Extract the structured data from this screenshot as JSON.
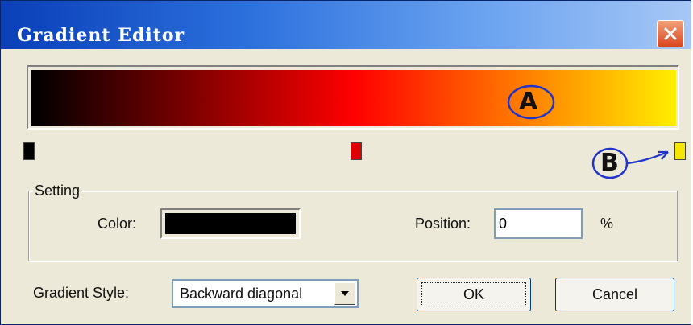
{
  "window": {
    "title": "Gradient Editor"
  },
  "gradient": {
    "colors": [
      "#000000",
      "#ff0000",
      "#ffee00"
    ]
  },
  "stops": [
    {
      "name": "stop-black",
      "color": "#000000"
    },
    {
      "name": "stop-red",
      "color": "#e00000"
    },
    {
      "name": "stop-yellow",
      "color": "#f5e600"
    }
  ],
  "annotations": {
    "a": "A",
    "b": "B",
    "arrow": "→"
  },
  "setting": {
    "group_label": "Setting",
    "color_label": "Color:",
    "color_value": "#000000",
    "position_label": "Position:",
    "position_value": "0",
    "percent_label": "%"
  },
  "footer": {
    "style_label": "Gradient Style:",
    "style_value": "Backward diagonal",
    "ok_label": "OK",
    "cancel_label": "Cancel"
  },
  "icons": {
    "close": "close-icon",
    "dropdown": "chevron-down-icon"
  }
}
